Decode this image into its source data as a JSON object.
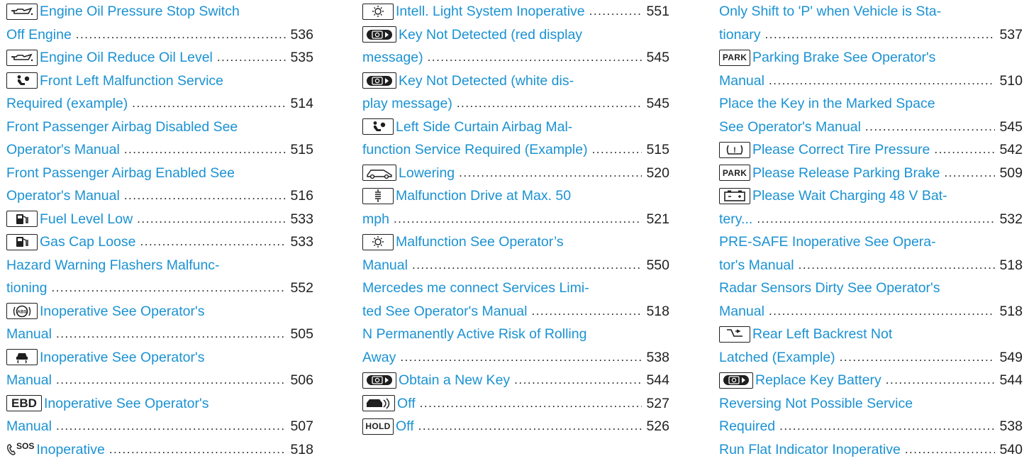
{
  "columns": [
    {
      "entries": [
        {
          "lines": [
            "Engine Oil Pressure Stop Switch",
            "Off Engine"
          ],
          "page": "536",
          "icon": {
            "name": "oil-can-icon",
            "label": "⛽"
          }
        },
        {
          "lines": [
            "Engine Oil Reduce Oil Level"
          ],
          "page": "535",
          "icon": {
            "name": "oil-can-icon",
            "label": ""
          }
        },
        {
          "lines": [
            "Front Left Malfunction Service",
            "Required (example)"
          ],
          "page": "514",
          "icon": {
            "name": "airbag-person-icon",
            "label": ""
          }
        },
        {
          "lines": [
            "Front Passenger Airbag Disabled See",
            "Operator's Manual"
          ],
          "page": "515"
        },
        {
          "lines": [
            "Front Passenger Airbag Enabled See",
            "Operator's Manual"
          ],
          "page": "516"
        },
        {
          "lines": [
            "Fuel Level Low"
          ],
          "page": "533",
          "icon": {
            "name": "fuel-pump-icon",
            "label": ""
          }
        },
        {
          "lines": [
            "Gas Cap Loose"
          ],
          "page": "533",
          "icon": {
            "name": "fuel-pump-icon",
            "label": ""
          }
        },
        {
          "lines": [
            "Hazard Warning Flashers Malfunc-",
            "tioning"
          ],
          "page": "552"
        },
        {
          "lines": [
            "Inoperative See Operator's",
            "Manual"
          ],
          "page": "505",
          "icon": {
            "name": "abs-icon",
            "label": "(ABS)"
          }
        },
        {
          "lines": [
            "Inoperative See Operator's",
            "Manual"
          ],
          "page": "506",
          "icon": {
            "name": "skidding-car-icon",
            "label": ""
          }
        },
        {
          "lines": [
            "Inoperative See Operator's",
            "Manual"
          ],
          "page": "507",
          "icon": {
            "name": "ebd-icon",
            "label": "EBD"
          }
        },
        {
          "lines": [
            "Inoperative"
          ],
          "page": "518",
          "icon": {
            "name": "sos-call-icon",
            "label": "SOS"
          }
        }
      ]
    },
    {
      "entries": [
        {
          "lines": [
            "Intell. Light System Inoperative"
          ],
          "page": "551",
          "icon": {
            "name": "light-sun-icon",
            "label": "-☼-"
          },
          "dots_end": "..."
        },
        {
          "lines": [
            "Key Not Detected   (red display",
            "message)"
          ],
          "page": "545",
          "icon": {
            "name": "key-icon",
            "label": ""
          }
        },
        {
          "lines": [
            "Key Not Detected   (white dis-",
            "play message)"
          ],
          "page": "545",
          "icon": {
            "name": "key-icon",
            "label": ""
          }
        },
        {
          "lines": [
            "Left Side Curtain Airbag Mal-",
            "function Service Required (Example)"
          ],
          "page": "515",
          "icon": {
            "name": "airbag-person-icon",
            "label": ""
          },
          "dots_end": "..."
        },
        {
          "lines": [
            "Lowering"
          ],
          "page": "520",
          "icon": {
            "name": "car-lowering-icon",
            "label": ""
          }
        },
        {
          "lines": [
            "Malfunction Drive at Max. 50",
            "mph"
          ],
          "page": "521",
          "icon": {
            "name": "suspension-icon",
            "label": ""
          }
        },
        {
          "lines": [
            "Malfunction See Operator’s",
            "Manual"
          ],
          "page": "550",
          "icon": {
            "name": "light-sun-icon",
            "label": "-☼-"
          }
        },
        {
          "lines": [
            "Mercedes me connect Services Limi-",
            "ted See Operator's Manual"
          ],
          "page": "518"
        },
        {
          "lines": [
            "N Permanently Active Risk of Rolling",
            "Away"
          ],
          "page": "538"
        },
        {
          "lines": [
            "Obtain a New Key"
          ],
          "page": "544",
          "icon": {
            "name": "key-icon",
            "label": ""
          }
        },
        {
          "lines": [
            "Off"
          ],
          "page": "527",
          "icon": {
            "name": "drive-pilot-icon",
            "label": ""
          }
        },
        {
          "lines": [
            "Off"
          ],
          "page": "526",
          "icon": {
            "name": "hold-icon",
            "label": "HOLD"
          }
        }
      ]
    },
    {
      "entries": [
        {
          "lines": [
            "Only Shift to 'P' when Vehicle is Sta-",
            "tionary"
          ],
          "page": "537"
        },
        {
          "lines": [
            "Parking Brake See Operator's",
            "Manual"
          ],
          "page": "510",
          "icon": {
            "name": "park-icon",
            "label": "PARK"
          }
        },
        {
          "lines": [
            "Place the Key in the Marked Space",
            "See Operator's Manual"
          ],
          "page": "545"
        },
        {
          "lines": [
            "Please Correct Tire Pressure"
          ],
          "page": "542",
          "icon": {
            "name": "tire-pressure-icon",
            "label": "(!)"
          }
        },
        {
          "lines": [
            "Please Release Parking Brake"
          ],
          "page": "509",
          "icon": {
            "name": "park-icon",
            "label": "PARK"
          }
        },
        {
          "lines": [
            "Please Wait Charging 48 V Bat-",
            "tery..."
          ],
          "page": "532",
          "icon": {
            "name": "battery-icon",
            "label": ""
          }
        },
        {
          "lines": [
            "PRE-SAFE Inoperative See Opera-",
            "tor's Manual"
          ],
          "page": "518"
        },
        {
          "lines": [
            "Radar Sensors Dirty See Operator's",
            "Manual"
          ],
          "page": "518"
        },
        {
          "lines": [
            "Rear Left Backrest Not",
            "Latched (Example)"
          ],
          "page": "549",
          "icon": {
            "name": "seat-backrest-icon",
            "label": ""
          }
        },
        {
          "lines": [
            "Replace Key Battery"
          ],
          "page": "544",
          "icon": {
            "name": "key-icon",
            "label": ""
          }
        },
        {
          "lines": [
            "Reversing Not Possible Service",
            "Required"
          ],
          "page": "538"
        },
        {
          "lines": [
            "Run Flat Indicator Inoperative"
          ],
          "page": "540"
        }
      ]
    }
  ]
}
